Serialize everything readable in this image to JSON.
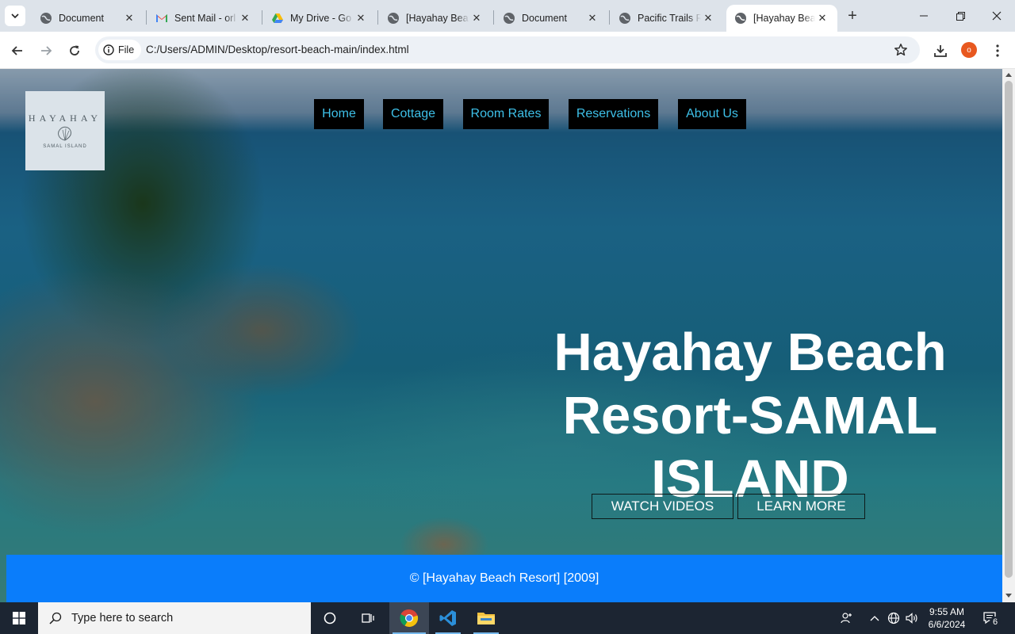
{
  "browser": {
    "tabs": [
      {
        "title": "Document",
        "icon": "globe-icon",
        "active": false
      },
      {
        "title": "Sent Mail - orl",
        "icon": "gmail-icon",
        "active": false
      },
      {
        "title": "My Drive - Go",
        "icon": "drive-icon",
        "active": false
      },
      {
        "title": "[Hayahay Bea",
        "icon": "globe-icon",
        "active": false
      },
      {
        "title": "Document",
        "icon": "globe-icon",
        "active": false
      },
      {
        "title": "Pacific Trails R",
        "icon": "globe-icon",
        "active": false
      },
      {
        "title": "[Hayahay Bea",
        "icon": "globe-icon",
        "active": true
      }
    ],
    "new_tab": "+",
    "address": {
      "chip_label": "File",
      "url": "C:/Users/ADMIN/Desktop/resort-beach-main/index.html"
    },
    "profile_initial": "o"
  },
  "page": {
    "logo": {
      "arc_text": "HAYAHAY",
      "sub_text": "SAMAL ISLAND"
    },
    "nav": [
      "Home",
      "Cottage",
      "Room Rates",
      "Reservations",
      "About Us"
    ],
    "hero_title": "Hayahay Beach Resort-SAMAL ISLAND",
    "buttons": {
      "watch": "WATCH VIDEOS",
      "learn": "LEARN MORE"
    },
    "footer": "© [Hayahay Beach Resort] [2009]"
  },
  "taskbar": {
    "search_placeholder": "Type here to search",
    "time": "9:55 AM",
    "date": "6/6/2024",
    "notification_count": "6"
  },
  "colors": {
    "nav_text": "#3ec0e8",
    "footer_bg": "#0a7dfb",
    "tabstrip_bg": "#dde3ea",
    "taskbar_bg": "#1c2532"
  }
}
